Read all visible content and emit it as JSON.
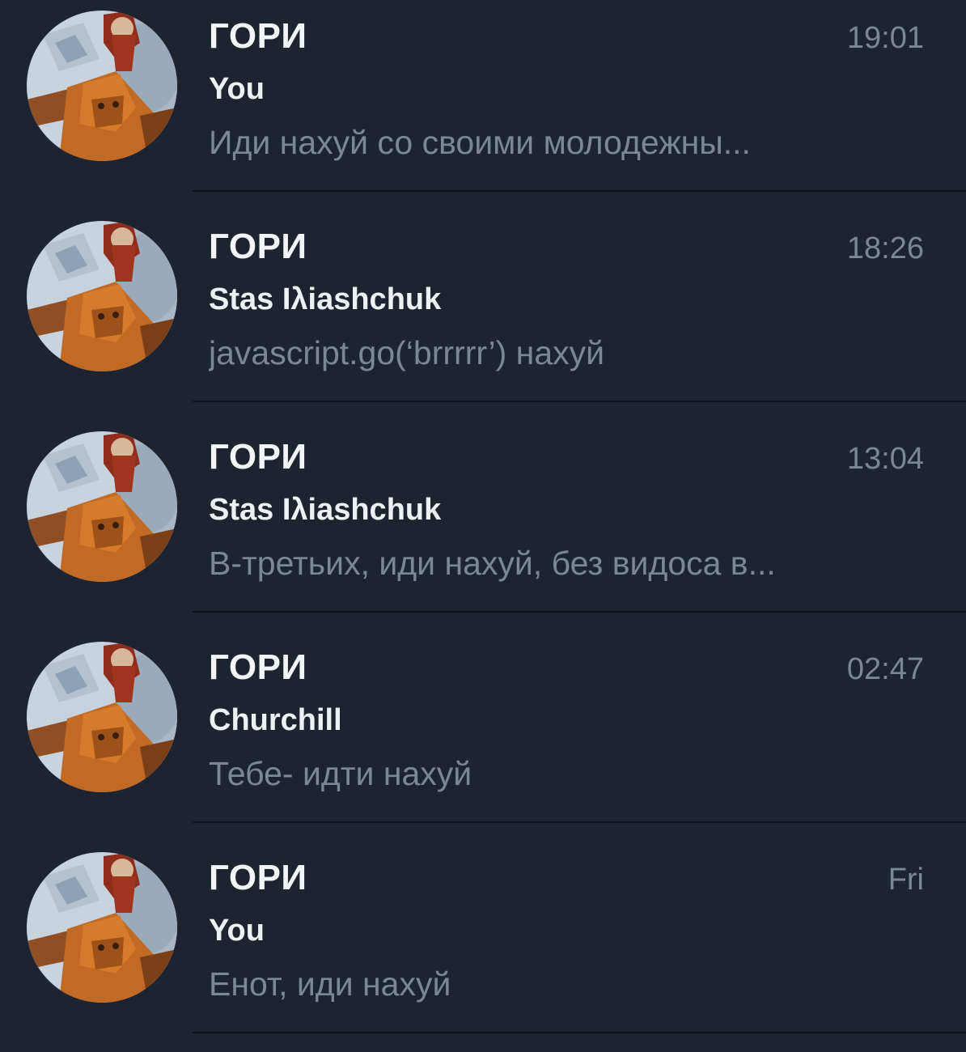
{
  "colors": {
    "background": "#1d2430",
    "title": "#f2f4f6",
    "meta": "#7d8793",
    "divider": "#0f141b"
  },
  "chats": [
    {
      "title": "ГОРИ",
      "time": "19:01",
      "sender": "You",
      "preview": "Иди нахуй со своими молодежны..."
    },
    {
      "title": "ГОРИ",
      "time": "18:26",
      "sender": "Stas Iλiashchuk",
      "preview": "javascript.go(‘brrrrr’) нахуй"
    },
    {
      "title": "ГОРИ",
      "time": "13:04",
      "sender": "Stas Iλiashchuk",
      "preview": "В-третьих, иди нахуй, без видоса в..."
    },
    {
      "title": "ГОРИ",
      "time": "02:47",
      "sender": "Churchill",
      "preview": "Тебе- идти нахуй"
    },
    {
      "title": "ГОРИ",
      "time": "Fri",
      "sender": "You",
      "preview": "Енот, иди нахуй"
    }
  ]
}
